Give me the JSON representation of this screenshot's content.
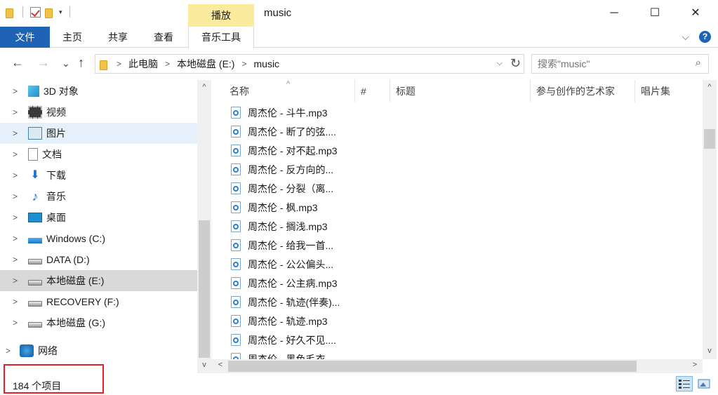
{
  "window": {
    "title": "music",
    "context_tab": "播放",
    "minimize": "─",
    "maximize": "☐",
    "close": "✕"
  },
  "ribbon": {
    "tabs": [
      "文件",
      "主页",
      "共享",
      "查看",
      "音乐工具"
    ],
    "expand": "⌵",
    "help": "?"
  },
  "nav_buttons": {
    "back": "←",
    "forward": "→",
    "recent": "⌄",
    "up": "↑"
  },
  "address": {
    "crumbs": [
      "此电脑",
      "本地磁盘 (E:)",
      "music"
    ],
    "chevron": ">",
    "dropdown": "⌵",
    "refresh": "↻"
  },
  "search": {
    "placeholder": "搜索\"music\"",
    "icon": "⌕"
  },
  "nav_pane": {
    "expander": ">",
    "items": [
      {
        "label": "3D 对象",
        "icon": "3d-objects-icon"
      },
      {
        "label": "视频",
        "icon": "video-icon"
      },
      {
        "label": "图片",
        "icon": "pictures-icon"
      },
      {
        "label": "文档",
        "icon": "documents-icon"
      },
      {
        "label": "下载",
        "icon": "downloads-icon",
        "glyph": "⬇"
      },
      {
        "label": "音乐",
        "icon": "music-icon",
        "glyph": "♪"
      },
      {
        "label": "桌面",
        "icon": "desktop-icon"
      },
      {
        "label": "Windows (C:)",
        "icon": "windows-drive-icon"
      },
      {
        "label": "DATA (D:)",
        "icon": "drive-icon"
      },
      {
        "label": "本地磁盘 (E:)",
        "icon": "drive-icon"
      },
      {
        "label": "RECOVERY (F:)",
        "icon": "drive-icon"
      },
      {
        "label": "本地磁盘 (G:)",
        "icon": "drive-icon"
      },
      {
        "label": "网络",
        "icon": "network-icon"
      }
    ]
  },
  "columns": [
    "名称",
    "#",
    "标题",
    "参与创作的艺术家",
    "唱片集"
  ],
  "sort_indicator": "^",
  "files": [
    "周杰伦 - 斗牛.mp3",
    "周杰伦 - 断了的弦....",
    "周杰伦 - 对不起.mp3",
    "周杰伦 - 反方向的...",
    "周杰伦 - 分裂（离...",
    "周杰伦 - 枫.mp3",
    "周杰伦 - 搁浅.mp3",
    "周杰伦 - 给我一首...",
    "周杰伦 - 公公偏头...",
    "周杰伦 - 公主病.mp3",
    "周杰伦 - 轨迹(伴奏)...",
    "周杰伦 - 轨迹.mp3",
    "周杰伦 - 好久不见....",
    "周杰伦 - 黑色毛衣..."
  ],
  "scroll": {
    "up": "^",
    "down": "v",
    "left": "<",
    "right": ">"
  },
  "status": {
    "item_count": "184 个项目"
  },
  "view_buttons": {
    "details": "details-view-icon",
    "large": "large-icons-view-icon"
  },
  "accent_color": "#1f63b5",
  "highlight_box_color": "#e81e25"
}
